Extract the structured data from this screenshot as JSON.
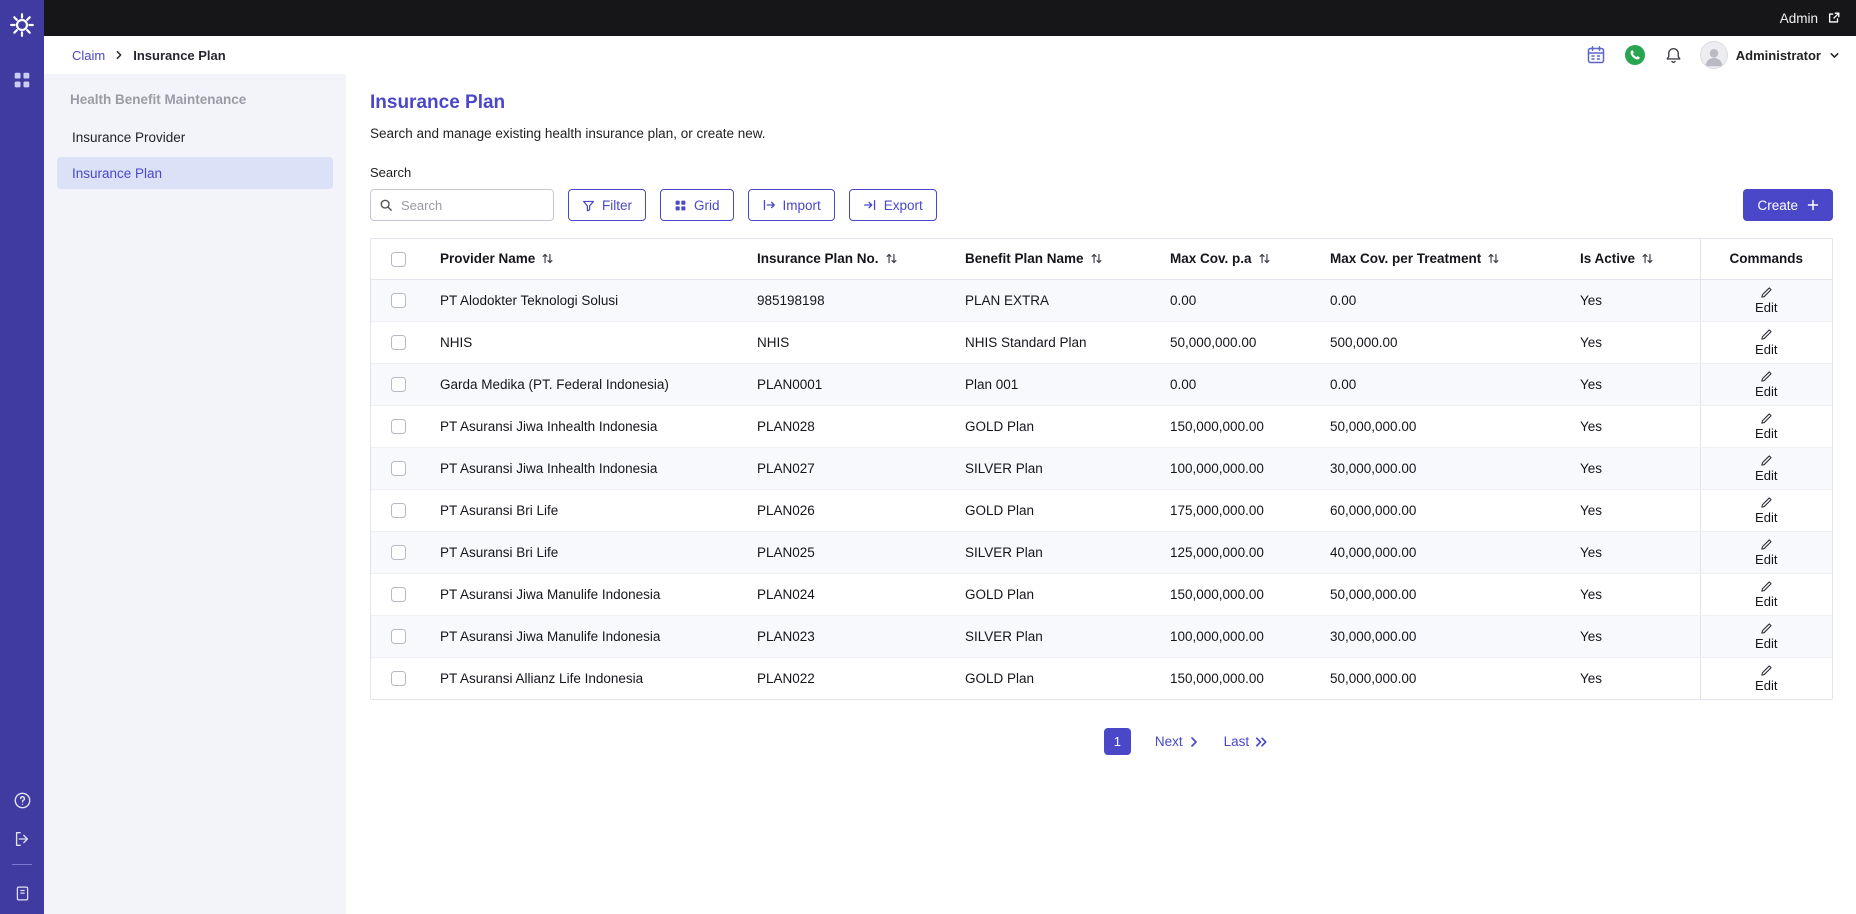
{
  "colors": {
    "accent": "#4a47c9",
    "sidebar_bg": "#3f3ba0",
    "topbar_bg": "#161619",
    "nav_bg": "#f2f4fa",
    "active_item_bg": "#dbe2f8",
    "row_stripe": "#f8f9fd",
    "whatsapp_green": "#29a552"
  },
  "topbar": {
    "label": "Admin"
  },
  "header": {
    "breadcrumb": {
      "parent": "Claim",
      "current": "Insurance Plan"
    },
    "user": "Administrator"
  },
  "icons": [
    "logo-gear-icon",
    "apps-grid-icon",
    "help-circle-icon",
    "logout-icon",
    "manual-book-icon",
    "external-link-icon",
    "calendar-icon",
    "whatsapp-icon",
    "bell-icon",
    "avatar-icon",
    "chevron-down-icon",
    "breadcrumb-chevron-icon",
    "search-icon",
    "filter-funnel-icon",
    "grid-icon",
    "import-icon",
    "export-icon",
    "plus-icon",
    "sort-arrows-icon",
    "pencil-icon",
    "next-chevron-icon",
    "last-double-chevron-icon"
  ],
  "nav": {
    "section": "Health Benefit Maintenance",
    "items": [
      {
        "label": "Insurance Provider",
        "active": false
      },
      {
        "label": "Insurance Plan",
        "active": true
      }
    ]
  },
  "main": {
    "title": "Insurance Plan",
    "subtitle": "Search and manage existing health insurance plan, or create new.",
    "search_label": "Search",
    "search_placeholder": "Search",
    "buttons": {
      "filter": "Filter",
      "grid": "Grid",
      "import": "Import",
      "export": "Export",
      "create": "Create"
    }
  },
  "table": {
    "columns": [
      "Provider Name",
      "Insurance Plan No.",
      "Benefit Plan Name",
      "Max Cov. p.a",
      "Max Cov. per Treatment",
      "Is Active",
      "Commands"
    ],
    "edit_label": "Edit",
    "rows": [
      {
        "provider": "PT Alodokter Teknologi Solusi",
        "plan_no": "985198198",
        "benefit": "PLAN EXTRA",
        "max_pa": "0.00",
        "max_treatment": "0.00",
        "active": "Yes"
      },
      {
        "provider": "NHIS",
        "plan_no": "NHIS",
        "benefit": "NHIS Standard Plan",
        "max_pa": "50,000,000.00",
        "max_treatment": "500,000.00",
        "active": "Yes"
      },
      {
        "provider": "Garda Medika (PT. Federal Indonesia)",
        "plan_no": "PLAN0001",
        "benefit": "Plan 001",
        "max_pa": "0.00",
        "max_treatment": "0.00",
        "active": "Yes"
      },
      {
        "provider": "PT Asuransi Jiwa Inhealth Indonesia",
        "plan_no": "PLAN028",
        "benefit": "GOLD Plan",
        "max_pa": "150,000,000.00",
        "max_treatment": "50,000,000.00",
        "active": "Yes"
      },
      {
        "provider": "PT Asuransi Jiwa Inhealth Indonesia",
        "plan_no": "PLAN027",
        "benefit": "SILVER Plan",
        "max_pa": "100,000,000.00",
        "max_treatment": "30,000,000.00",
        "active": "Yes"
      },
      {
        "provider": "PT Asuransi Bri Life",
        "plan_no": "PLAN026",
        "benefit": "GOLD Plan",
        "max_pa": "175,000,000.00",
        "max_treatment": "60,000,000.00",
        "active": "Yes"
      },
      {
        "provider": "PT Asuransi Bri Life",
        "plan_no": "PLAN025",
        "benefit": "SILVER Plan",
        "max_pa": "125,000,000.00",
        "max_treatment": "40,000,000.00",
        "active": "Yes"
      },
      {
        "provider": "PT Asuransi Jiwa Manulife Indonesia",
        "plan_no": "PLAN024",
        "benefit": "GOLD Plan",
        "max_pa": "150,000,000.00",
        "max_treatment": "50,000,000.00",
        "active": "Yes"
      },
      {
        "provider": "PT Asuransi Jiwa Manulife Indonesia",
        "plan_no": "PLAN023",
        "benefit": "SILVER Plan",
        "max_pa": "100,000,000.00",
        "max_treatment": "30,000,000.00",
        "active": "Yes"
      },
      {
        "provider": "PT Asuransi Allianz Life Indonesia",
        "plan_no": "PLAN022",
        "benefit": "GOLD Plan",
        "max_pa": "150,000,000.00",
        "max_treatment": "50,000,000.00",
        "active": "Yes"
      }
    ]
  },
  "pagination": {
    "current": "1",
    "next": "Next",
    "last": "Last"
  }
}
